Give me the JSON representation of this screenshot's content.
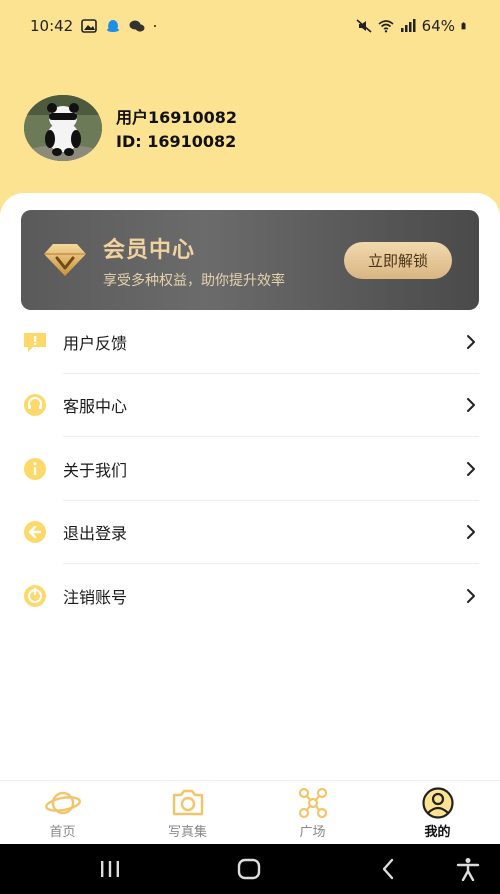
{
  "status_bar": {
    "time": "10:42",
    "battery": "64%",
    "icons": [
      "gallery-icon",
      "qq-icon",
      "wechat-icon",
      "dot-icon",
      "mute-icon",
      "wifi-icon",
      "signal-icon",
      "battery-icon"
    ]
  },
  "profile": {
    "name": "用户16910082",
    "id": "ID: 16910082",
    "avatar": "panda-avatar"
  },
  "vip": {
    "title": "会员中心",
    "subtitle": "享受多种权益，助你提升效率",
    "button": "立即解锁",
    "icon": "diamond-icon"
  },
  "menu": {
    "items": [
      {
        "label": "用户反馈",
        "icon": "feedback-icon"
      },
      {
        "label": "客服中心",
        "icon": "customer-service-icon"
      },
      {
        "label": "关于我们",
        "icon": "info-icon"
      },
      {
        "label": "退出登录",
        "icon": "logout-icon"
      },
      {
        "label": "注销账号",
        "icon": "cancel-account-icon"
      }
    ]
  },
  "tabs": [
    {
      "label": "首页",
      "icon": "planet-icon",
      "active": false
    },
    {
      "label": "写真集",
      "icon": "camera-icon",
      "active": false
    },
    {
      "label": "广场",
      "icon": "network-icon",
      "active": false
    },
    {
      "label": "我的",
      "icon": "user-icon",
      "active": true
    }
  ],
  "colors": {
    "header_bg": "#fce391",
    "icon_yellow": "#fcd96a",
    "vip_gold": "#f2d3a0",
    "tab_active": "#111111",
    "tab_inactive": "#888888"
  }
}
